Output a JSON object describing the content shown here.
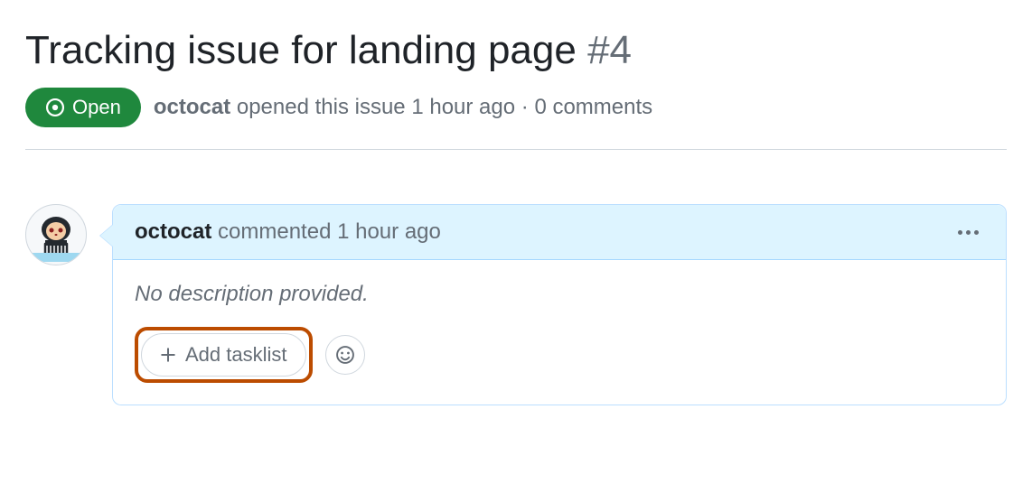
{
  "issue": {
    "title": "Tracking issue for landing page",
    "number": "#4",
    "status": "Open",
    "author": "octocat",
    "opened_text": "opened this issue",
    "opened_time": "1 hour ago",
    "separator": "·",
    "comments_count": "0 comments"
  },
  "comment": {
    "author": "octocat",
    "action": "commented",
    "time": "1 hour ago",
    "body": "No description provided.",
    "add_tasklist_label": "Add tasklist"
  }
}
